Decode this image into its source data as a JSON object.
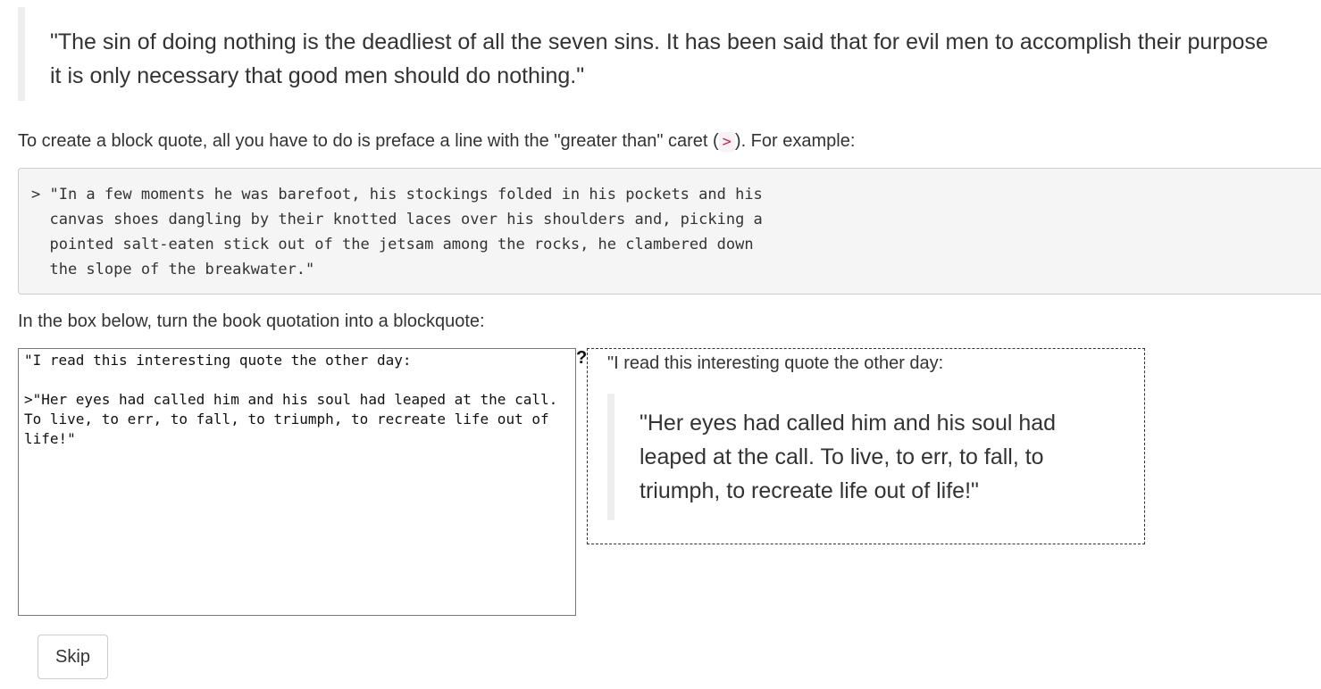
{
  "top_quote": {
    "line1": "\"The sin of doing nothing is the deadliest of all the seven sins. It has been said that for evil men to accomplish their purpose",
    "line2": "it is only necessary that good men should do nothing.\""
  },
  "intro": {
    "before": "To create a block quote, all you have to do is preface a line with the \"greater than\" caret (",
    "caret": ">",
    "after": "). For example:"
  },
  "example_code": "> \"In a few moments he was barefoot, his stockings folded in his pockets and his\n  canvas shoes dangling by their knotted laces over his shoulders and, picking a\n  pointed salt-eaten stick out of the jetsam among the rocks, he clambered down\n  the slope of the breakwater.\"",
  "instruction": "In the box below, turn the book quotation into a blockquote:",
  "editor": {
    "value": "\"I read this interesting quote the other day:\n\n>\"Her eyes had called him and his soul had leaped at the call. To live, to err, to fall, to triumph, to recreate life out of life!\""
  },
  "help_icon": "?",
  "preview": {
    "intro": "\"I read this interesting quote the other day:",
    "quote": "\"Her eyes had called him and his soul had leaped at the call. To live, to err, to fall, to triumph, to recreate life out of life!\""
  },
  "skip_label": "Skip",
  "icons": {
    "help": "help-icon"
  }
}
